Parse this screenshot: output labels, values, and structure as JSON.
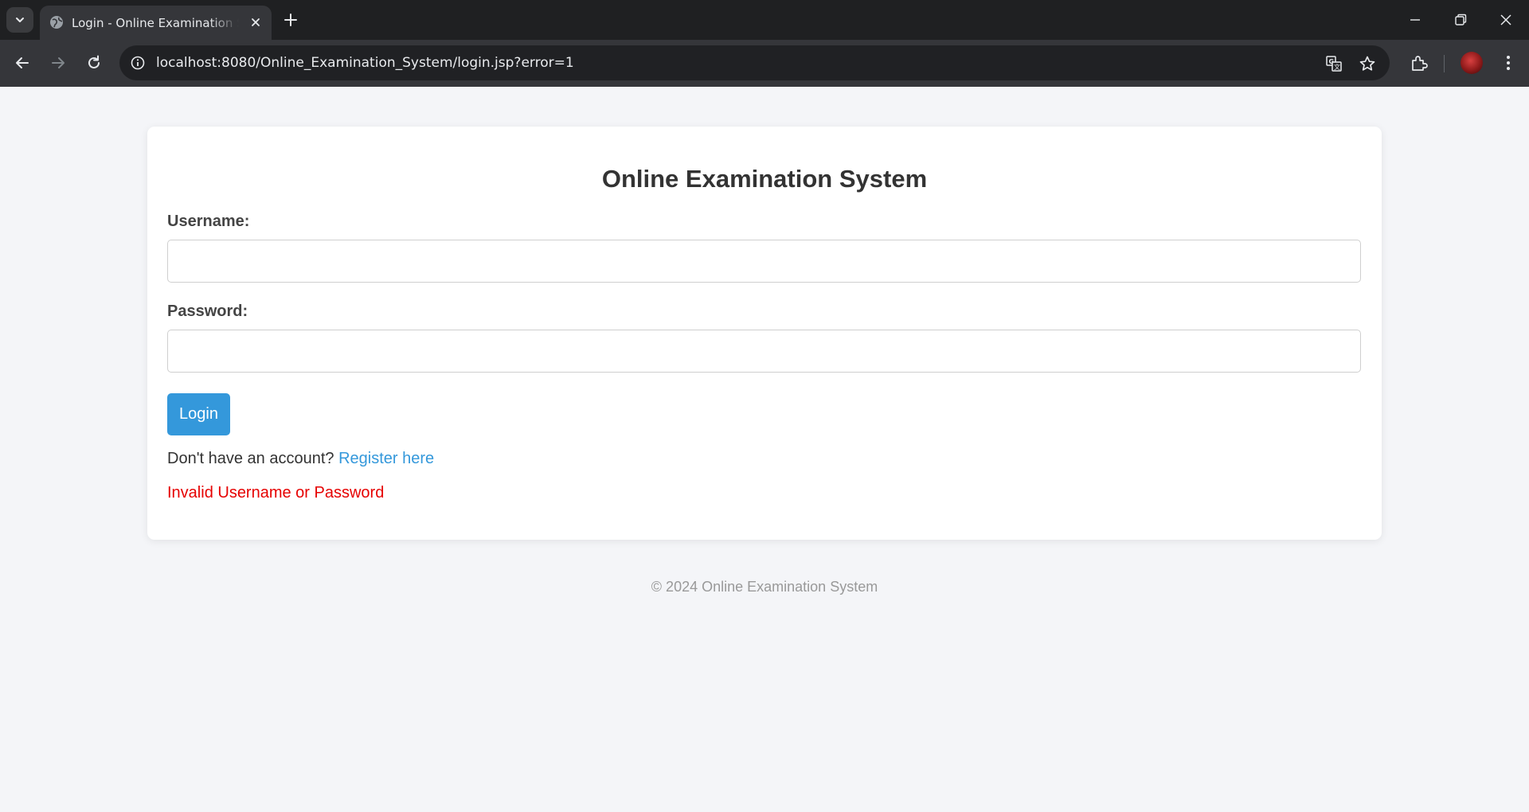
{
  "browser": {
    "tab_title": "Login - Online Examination System",
    "url": "localhost:8080/Online_Examination_System/login.jsp?error=1",
    "icons": [
      "tab-list-icon",
      "globe-icon",
      "close-icon",
      "plus-icon",
      "minimize-icon",
      "restore-icon",
      "close-window-icon",
      "back-icon",
      "forward-icon",
      "reload-icon",
      "info-icon",
      "translate-icon",
      "star-icon",
      "extensions-icon",
      "avatar",
      "more-vert-icon"
    ]
  },
  "page": {
    "title": "Online Examination System",
    "username_label": "Username:",
    "username_value": "",
    "password_label": "Password:",
    "password_value": "",
    "login_button": "Login",
    "register_prompt": "Don't have an account?",
    "register_link": "Register here",
    "error_message": "Invalid Username or Password",
    "footer": "© 2024 Online Examination System"
  },
  "colors": {
    "accent": "#3498db",
    "error": "#e60000",
    "page_background": "#f4f5f8"
  }
}
